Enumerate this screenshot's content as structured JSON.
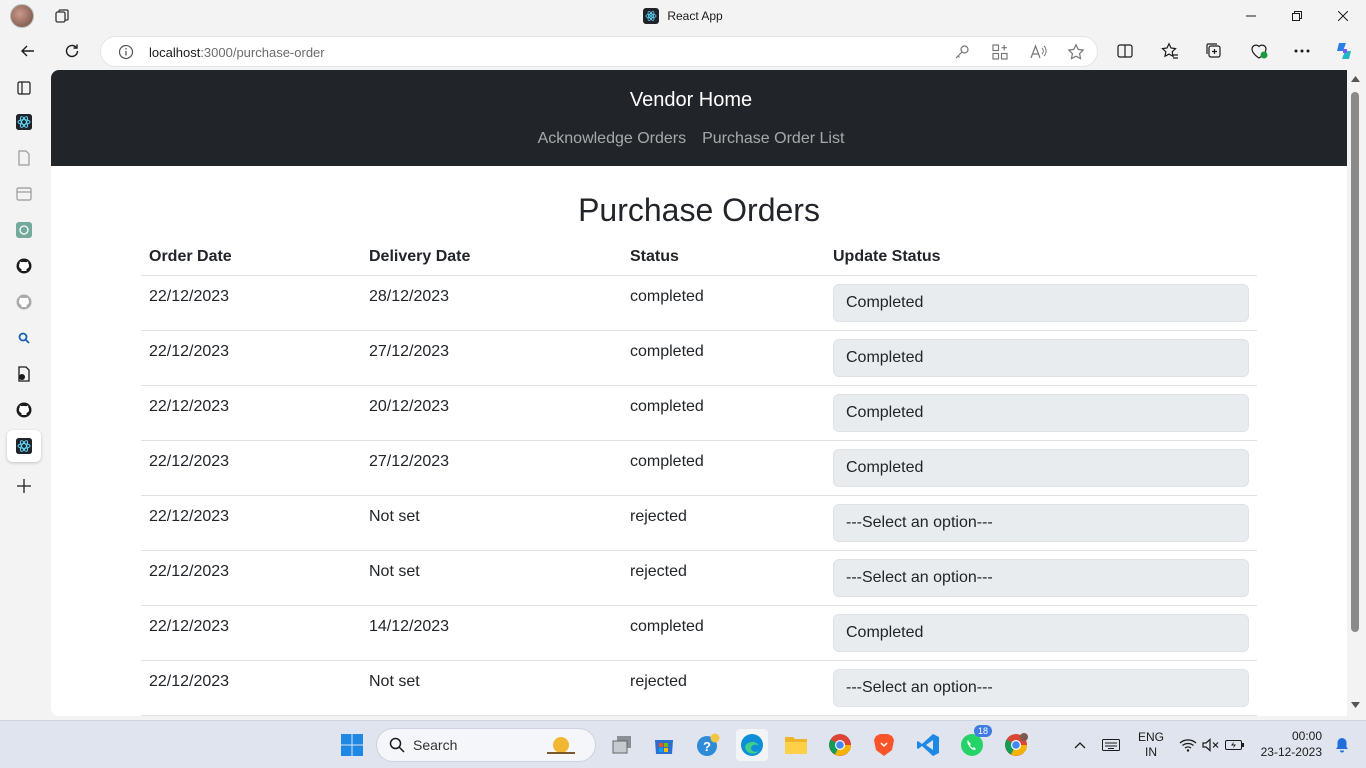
{
  "browser": {
    "tab_title": "React App",
    "url_host": "localhost",
    "url_rest": ":3000/purchase-order"
  },
  "app": {
    "brand": "Vendor Home",
    "nav_links": [
      "Acknowledge Orders",
      "Purchase Order List"
    ],
    "page_title": "Purchase Orders",
    "table": {
      "headers": [
        "Order Date",
        "Delivery Date",
        "Status",
        "Update Status"
      ],
      "rows": [
        {
          "order_date": "22/12/2023",
          "delivery_date": "28/12/2023",
          "status": "completed",
          "update": "Completed"
        },
        {
          "order_date": "22/12/2023",
          "delivery_date": "27/12/2023",
          "status": "completed",
          "update": "Completed"
        },
        {
          "order_date": "22/12/2023",
          "delivery_date": "20/12/2023",
          "status": "completed",
          "update": "Completed"
        },
        {
          "order_date": "22/12/2023",
          "delivery_date": "27/12/2023",
          "status": "completed",
          "update": "Completed"
        },
        {
          "order_date": "22/12/2023",
          "delivery_date": "Not set",
          "status": "rejected",
          "update": "---Select an option---"
        },
        {
          "order_date": "22/12/2023",
          "delivery_date": "Not set",
          "status": "rejected",
          "update": "---Select an option---"
        },
        {
          "order_date": "22/12/2023",
          "delivery_date": "14/12/2023",
          "status": "completed",
          "update": "Completed"
        },
        {
          "order_date": "22/12/2023",
          "delivery_date": "Not set",
          "status": "rejected",
          "update": "---Select an option---"
        }
      ]
    }
  },
  "taskbar": {
    "search_label": "Search",
    "whatsapp_badge": "18",
    "lang_line1": "ENG",
    "lang_line2": "IN",
    "time": "00:00",
    "date": "23-12-2023"
  },
  "colors": {
    "navbar_bg": "#212529",
    "select_bg": "#e9ecef"
  }
}
